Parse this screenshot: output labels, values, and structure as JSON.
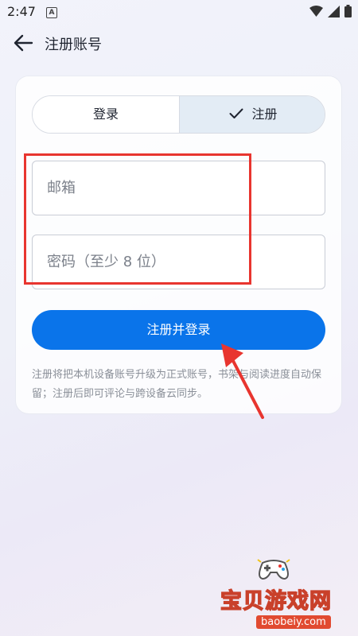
{
  "status": {
    "time": "2:47",
    "a_badge": "A"
  },
  "header": {
    "title": "注册账号"
  },
  "tabs": [
    {
      "label": "登录",
      "active": false
    },
    {
      "label": "注册",
      "active": true
    }
  ],
  "form": {
    "email_placeholder": "邮箱",
    "password_placeholder": "密码（至少 8 位）",
    "submit_label": "注册并登录"
  },
  "hint": "注册将把本机设备账号升级为正式账号，书架与阅读进度自动保留；注册后即可评论与跨设备云同步。",
  "watermark": {
    "name": "宝贝游戏网",
    "url": "baobeiy.com"
  },
  "colors": {
    "accent": "#0a74ea",
    "tab_active_bg": "#e3ecf5",
    "annotation": "#e8352f"
  },
  "icons": {
    "back": "arrow-left-icon",
    "check": "check-icon",
    "wifi": "wifi-icon",
    "signal": "signal-icon",
    "battery": "battery-icon"
  }
}
